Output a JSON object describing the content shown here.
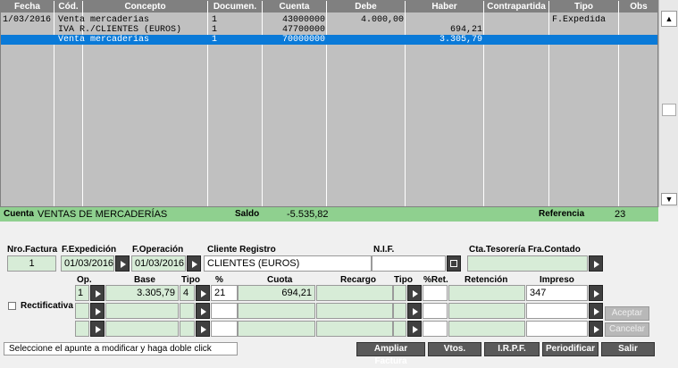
{
  "grid": {
    "headers": [
      "Fecha",
      "Cód.",
      "Concepto",
      "Documen.",
      "Cuenta",
      "Debe",
      "Haber",
      "Contrapartida",
      "Tipo",
      "Obs"
    ],
    "rows": [
      {
        "fecha": "1/03/2016",
        "cod": "",
        "concepto": "Venta mercaderías",
        "documento": "1",
        "cuenta": "43000000",
        "debe": "4.000,00",
        "haber": "",
        "contrapartida": "",
        "tipo": "F.Expedida",
        "obs": ""
      },
      {
        "fecha": "",
        "cod": "",
        "concepto": "IVA R./CLIENTES (EUROS)",
        "documento": "1",
        "cuenta": "47700000",
        "debe": "",
        "haber": "694,21",
        "contrapartida": "",
        "tipo": "",
        "obs": ""
      },
      {
        "fecha": "",
        "cod": "",
        "concepto": "Venta mercaderías",
        "documento": "1",
        "cuenta": "70000000",
        "debe": "",
        "haber": "3.305,79",
        "contrapartida": "",
        "tipo": "",
        "obs": ""
      }
    ]
  },
  "scroll": {
    "up_icon": "triangle-up",
    "down_icon": "triangle-down"
  },
  "status": {
    "cuenta_label": "Cuenta",
    "cuenta_value": "VENTAS DE MERCADERÍAS",
    "saldo_label": "Saldo",
    "saldo_value": "-5.535,82",
    "referencia_label": "Referencia",
    "referencia_value": "23"
  },
  "form": {
    "nro_factura_label": "Nro.Factura",
    "nro_factura": "1",
    "f_expedicion_label": "F.Expedición",
    "f_expedicion": "01/03/2016",
    "f_operacion_label": "F.Operación",
    "f_operacion": "01/03/2016",
    "cliente_label": "Cliente Registro",
    "cliente": "CLIENTES (EUROS)",
    "nif_label": "N.I.F.",
    "nif": "",
    "cta_label": "Cta.Tesorería Fra.Contado",
    "cta": ""
  },
  "vat": {
    "headers": {
      "op": "Op.",
      "base": "Base",
      "tipo": "Tipo",
      "pct": "%",
      "cuota": "Cuota",
      "recargo": "Recargo",
      "tipo2": "Tipo",
      "pctret": "%Ret.",
      "retencion": "Retención",
      "impreso": "Impreso"
    },
    "row1": {
      "op": "1",
      "base": "3.305,79",
      "tipo": "4",
      "pct": "21",
      "cuota": "694,21",
      "recargo": "",
      "impreso": "347"
    }
  },
  "rectificativa_label": "Rectificativa",
  "buttons": {
    "aceptar": "Aceptar",
    "cancelar": "Cancelar",
    "ampliar": "Ampliar Factura",
    "vtos": "Vtos.",
    "irpf": "I.R.P.F.",
    "periodificar": "Periodificar",
    "salir": "Salir"
  },
  "hint": "Seleccione el apunte a modificar y haga doble click"
}
